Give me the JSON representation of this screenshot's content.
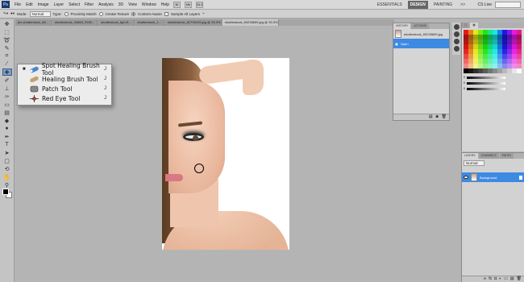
{
  "menubar": {
    "logo": "Ps",
    "items": [
      "File",
      "Edit",
      "Image",
      "Layer",
      "Select",
      "Filter",
      "Analysis",
      "3D",
      "View",
      "Window",
      "Help"
    ],
    "zoom": "33.3",
    "workspaces": [
      "ESSENTIALS",
      "DESIGN",
      "PAINTING",
      ">>"
    ],
    "cs_live": "CS Live"
  },
  "options": {
    "mode_label": "Mode:",
    "mode_value": "Normal",
    "type_label": "Type:",
    "types": [
      "Proximity Match",
      "Create Texture",
      "Content-Aware"
    ],
    "sample_all": "Sample All Layers"
  },
  "tabs": [
    "pix-shutterstock_86...",
    "shutterstock_94863_RGB...",
    "shutterstock_fgd-f3...",
    "shutterstock_1...",
    "shutterstock_82790109.jpg @ 33.3% (RGB/8)",
    "shutterstock_69235659.jpg @ 33.3% (RGB/8)"
  ],
  "flyout": {
    "items": [
      {
        "label": "Spot Healing Brush Tool",
        "key": "J",
        "active": true
      },
      {
        "label": "Healing Brush Tool",
        "key": "J",
        "active": false
      },
      {
        "label": "Patch Tool",
        "key": "J",
        "active": false
      },
      {
        "label": "Red Eye Tool",
        "key": "J",
        "active": false
      }
    ]
  },
  "history": {
    "tabs": [
      "HISTORY",
      "ACTIONS"
    ],
    "snapshot": "shutterstock_69235659.jpg",
    "state": "Open"
  },
  "layers": {
    "tabs": [
      "LAYERS",
      "CHANNELS",
      "PATHS"
    ],
    "blend": "Normal",
    "layer_name": "Background"
  },
  "colors": {
    "accent": "#3d8ae3",
    "active_tool": "#7f9cc4"
  }
}
